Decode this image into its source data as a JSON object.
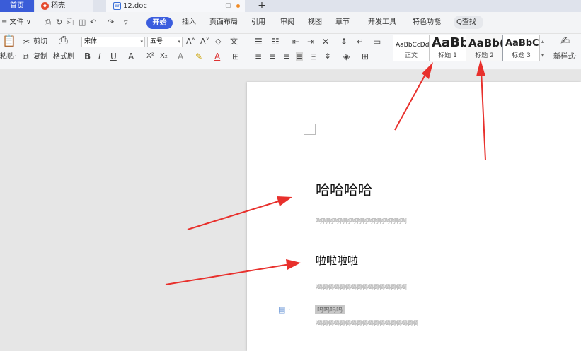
{
  "tabs": {
    "home": "首页",
    "daoke": "稻壳",
    "doc": "12.doc",
    "add": "+"
  },
  "menu": {
    "file": "≡ 文件 ∨",
    "quick_icons": [
      "save-icon",
      "redo-history-icon",
      "print-icon",
      "print-preview-icon",
      "undo-icon",
      "redo-icon",
      "customize-icon"
    ],
    "start": "开始",
    "items": [
      "插入",
      "页面布局",
      "引用",
      "审阅",
      "视图",
      "章节",
      "开发工具",
      "特色功能"
    ],
    "search": "Q查找"
  },
  "ribbon": {
    "paste": "粘贴·",
    "cut": "剪切",
    "copy": "复制",
    "format_painter": "格式刷",
    "font_name": "宋体",
    "font_size": "五号",
    "styles": [
      {
        "preview": "AaBbCcDd",
        "label": "正文"
      },
      {
        "preview": "AaBb",
        "label": "标题 1"
      },
      {
        "preview": "AaBb(",
        "label": "标题 2"
      },
      {
        "preview": "AaBbC",
        "label": "标题 3"
      }
    ],
    "new_style": "新样式·"
  },
  "document": {
    "heading1": "哈哈哈哈",
    "body1": "啊啊啊啊啊啊啊啊啊啊啊啊啊啊啊啊",
    "heading2": "啦啦啦啦",
    "body2": "啊啊啊啊啊啊啊啊啊啊啊啊啊啊啊啊",
    "highlight": "呜呜呜呜",
    "body3": "啊啊啊啊啊啊啊啊啊啊啊啊啊啊啊啊啊啊"
  },
  "colors": {
    "accent": "#3b5dde",
    "arrow": "#e8302c",
    "tab_home": "#3a5cd8"
  }
}
